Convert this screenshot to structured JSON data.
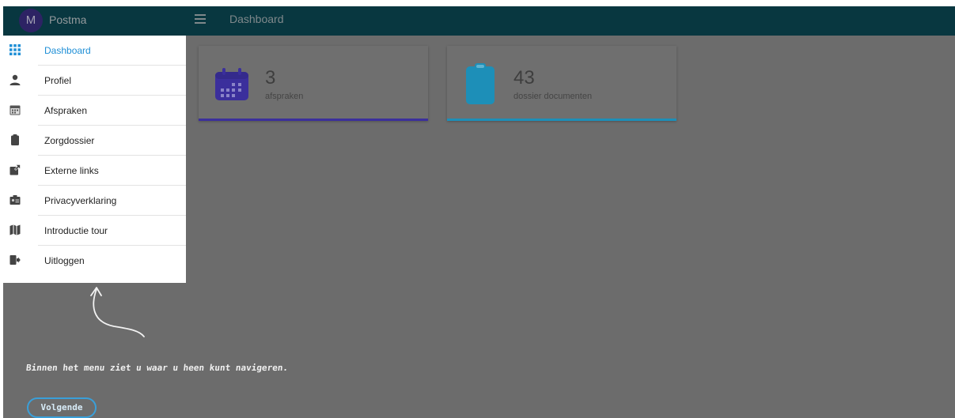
{
  "header": {
    "avatar_initial": "M",
    "app_name": "Postma",
    "page_title": "Dashboard"
  },
  "sidebar": {
    "items": [
      {
        "label": "Dashboard",
        "icon": "grid-icon",
        "active": true
      },
      {
        "label": "Profiel",
        "icon": "person-icon"
      },
      {
        "label": "Afspraken",
        "icon": "calendar-icon"
      },
      {
        "label": "Zorgdossier",
        "icon": "clipboard-icon"
      },
      {
        "label": "Externe links",
        "icon": "external-link-icon"
      },
      {
        "label": "Privacyverklaring",
        "icon": "id-card-icon"
      },
      {
        "label": "Introductie tour",
        "icon": "map-icon"
      },
      {
        "label": "Uitloggen",
        "icon": "logout-icon"
      }
    ]
  },
  "cards": [
    {
      "value": "3",
      "label": "afspraken",
      "icon": "calendar-icon",
      "accent": "#3b2f9c"
    },
    {
      "value": "43",
      "label": "dossier documenten",
      "icon": "clipboard-icon",
      "accent": "#1d8fb8"
    }
  ],
  "tour": {
    "message": "Binnen het menu ziet u waar u heen kunt navigeren.",
    "next_label": "Volgende"
  },
  "colors": {
    "topbar": "#0b4a56",
    "overlay": "#6c6c6c",
    "active_link": "#1f8fd6"
  }
}
